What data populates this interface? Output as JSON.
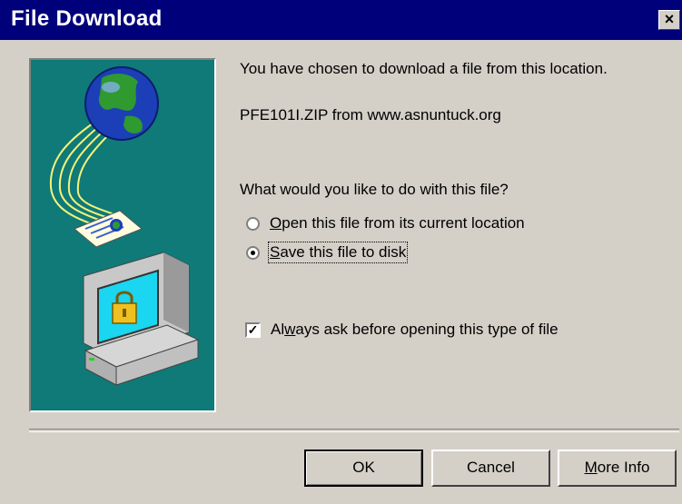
{
  "window": {
    "title": "File Download",
    "close_glyph": "×"
  },
  "message": {
    "intro": "You have chosen to download a file from this location.",
    "file_source": "PFE101I.ZIP from www.asnuntuck.org",
    "question": "What would you like to do with this file?"
  },
  "options": [
    {
      "label_mnemonic": "O",
      "label_rest": "pen this file from its current location",
      "selected": false
    },
    {
      "label_mnemonic": "S",
      "label_rest": "ave this file to disk",
      "selected": true
    }
  ],
  "always_ask": {
    "label_pre": "Al",
    "label_mnemonic": "w",
    "label_rest": "ays ask before opening this type of file",
    "checked": true,
    "check_glyph": "✓"
  },
  "buttons": {
    "ok": "OK",
    "cancel": "Cancel",
    "more_info_mnemonic": "M",
    "more_info_rest": "ore Info"
  },
  "colors": {
    "title_bar": "#00007b",
    "face": "#d4d0c8",
    "illustration_bg": "#0f7a78"
  },
  "icons": [
    "globe-icon",
    "document-icon",
    "computer-icon",
    "padlock-icon",
    "close-icon"
  ]
}
